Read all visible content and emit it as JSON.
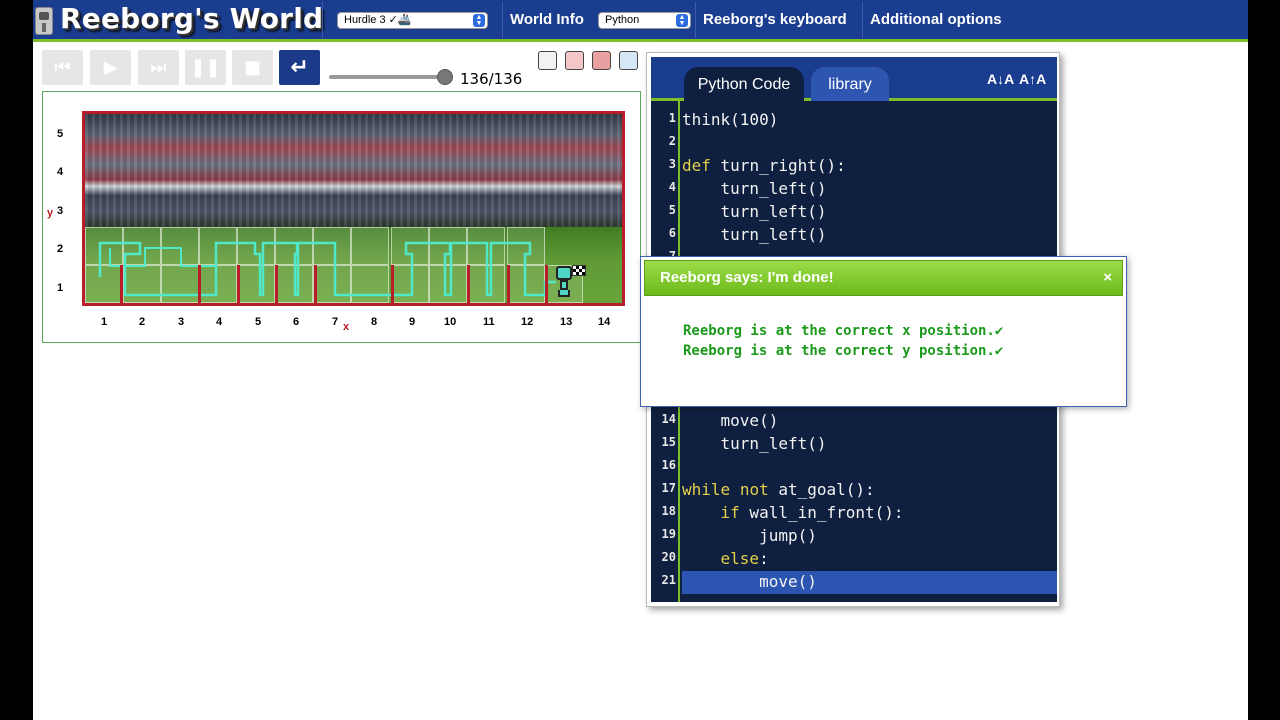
{
  "app": {
    "title": "Reeborg's World"
  },
  "topbar": {
    "world_select": "Hurdle 3 ✓🚢",
    "world_info": "World Info",
    "language_select": "Python",
    "keyboard": "Reeborg's keyboard",
    "options": "Additional options"
  },
  "controls": {
    "reload_icon": "↵",
    "step": "136/136",
    "slider_value": 1.0,
    "buttons": [
      "reverse-step-icon",
      "play-icon",
      "step-icon",
      "pause-icon",
      "stop-icon",
      "reload-icon"
    ],
    "extra_icons": [
      "memorize-world-icon",
      "remove-robot-icon",
      "delete-world-icon",
      "edit-world-icon"
    ]
  },
  "world": {
    "y_axis_name": "y",
    "x_axis_name": "x",
    "y_ticks": [
      "5",
      "4",
      "3",
      "2",
      "1"
    ],
    "x_ticks": [
      "1",
      "2",
      "3",
      "4",
      "5",
      "6",
      "7",
      "8",
      "9",
      "10",
      "11",
      "12",
      "13",
      "14"
    ],
    "wall_color": "#b81d2a",
    "trace_color": "#4fe8c8"
  },
  "editor": {
    "tab_code": "Python Code",
    "tab_library": "library",
    "font_smaller": "A↓A",
    "font_larger": "A↑A",
    "lines": [
      {
        "n": "1",
        "t": "think(100)"
      },
      {
        "n": "2",
        "t": ""
      },
      {
        "n": "3",
        "t": "def turn_right():"
      },
      {
        "n": "4",
        "t": "    turn_left()"
      },
      {
        "n": "5",
        "t": "    turn_left()"
      },
      {
        "n": "6",
        "t": "    turn_left()"
      },
      {
        "n": "7",
        "t": ""
      },
      {
        "n": "14",
        "t": "    move()"
      },
      {
        "n": "15",
        "t": "    turn_left()"
      },
      {
        "n": "16",
        "t": ""
      },
      {
        "n": "17",
        "t": "while not at_goal():"
      },
      {
        "n": "18",
        "t": "    if wall_in_front():"
      },
      {
        "n": "19",
        "t": "        jump()"
      },
      {
        "n": "20",
        "t": "    else:"
      },
      {
        "n": "21",
        "t": "        move()"
      }
    ],
    "highlighted_line": "21"
  },
  "dialog": {
    "title": "Reeborg says: I'm done!",
    "close": "×",
    "messages": [
      "Reeborg is at the correct x position.",
      "Reeborg is at the correct y position."
    ],
    "check": "✔"
  }
}
